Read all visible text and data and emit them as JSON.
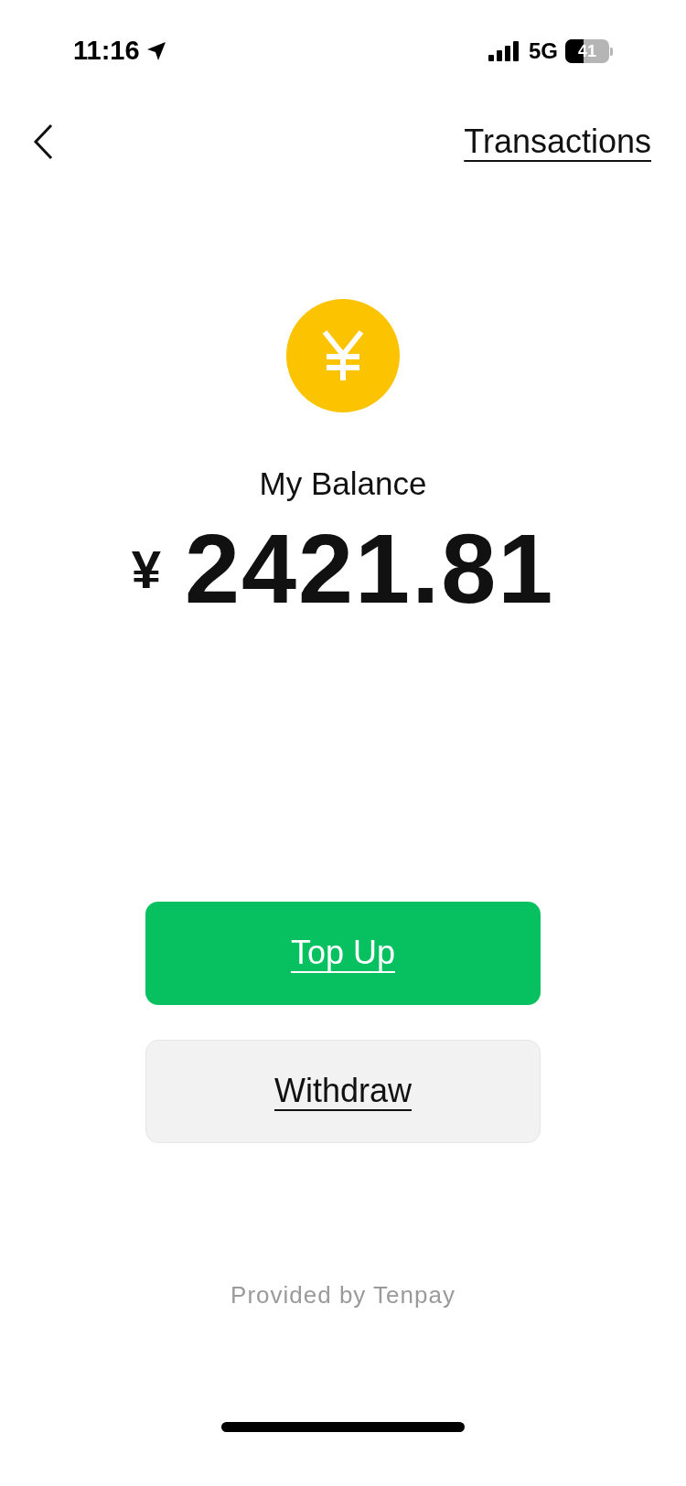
{
  "status_bar": {
    "time": "11:16",
    "network": "5G",
    "battery": "41"
  },
  "nav": {
    "link": "Transactions"
  },
  "balance": {
    "label": "My Balance",
    "currency": "¥",
    "amount": "2421.81"
  },
  "buttons": [
    {
      "label": "Top Up",
      "kind": "primary"
    },
    {
      "label": "Withdraw",
      "kind": "secondary"
    }
  ],
  "footer": "Provided by Tenpay"
}
